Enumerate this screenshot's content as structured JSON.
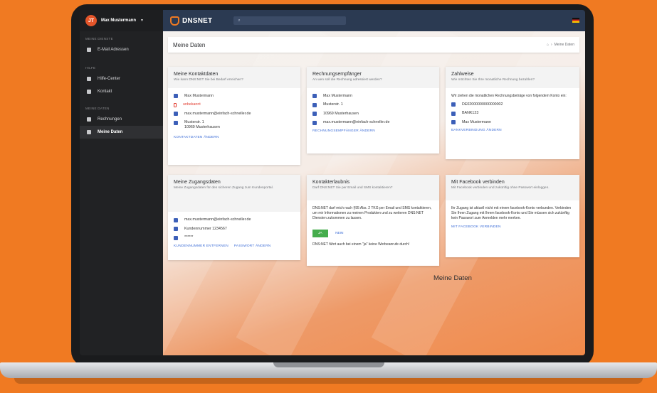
{
  "sidebar": {
    "user": {
      "initials": "JT",
      "name": "Max Mustermann"
    },
    "sections": [
      {
        "label": "MEINE DIENSTE",
        "items": [
          {
            "label": "E-Mail Adressen",
            "icon": "mail-icon"
          }
        ]
      },
      {
        "label": "HILFE",
        "items": [
          {
            "label": "Hilfe-Center",
            "icon": "book-icon"
          },
          {
            "label": "Kontakt",
            "icon": "chat-icon"
          }
        ]
      },
      {
        "label": "MEINE DATEN",
        "items": [
          {
            "label": "Rechnungen",
            "icon": "invoice-icon"
          },
          {
            "label": "Meine Daten",
            "icon": "card-icon",
            "active": true
          }
        ]
      }
    ]
  },
  "topbar": {
    "logo_text": "DNSNET",
    "search_placeholder": ""
  },
  "header": {
    "title": "Meine Daten",
    "breadcrumb_home": "home",
    "breadcrumb_current": "Meine Daten"
  },
  "cards": {
    "contact": {
      "title": "Meine Kontaktdaten",
      "subtitle": "Wie kann DNS:NET Sie bei Bedarf erreichen?",
      "rows": [
        "Max Mustermann",
        "unbekannt",
        "max.mustermann@einfach-schneller.de",
        "Musterstr. 1",
        "10969 Musterhausen"
      ],
      "link": "KONTAKTDATEN ÄNDERN"
    },
    "billing": {
      "title": "Rechnungsempfänger",
      "subtitle": "An wen soll die Rechnung adressiert werden?",
      "rows": [
        "Max Mustermann",
        "Musterstr. 1",
        "10969 Musterhausen",
        "max.mustermann@einfach-schneller.de"
      ],
      "link": "RECHNUNGSEMPFÄNGER ÄNDERN"
    },
    "payment": {
      "title": "Zahlweise",
      "subtitle": "Wie möchten Sie Ihre monatliche Rechnung bezahlen?",
      "intro": "Wir ziehen die monatlichen Rechnungsbeträge von folgendem Konto ein:",
      "rows": [
        "DE02000000000000002",
        "BANK123",
        "Max Mustermann"
      ],
      "link": "BANKVERBINDUNG ÄNDERN"
    },
    "access": {
      "title": "Meine Zugangsdaten",
      "subtitle": "Meine Zugangsdaten für den sicheren Zugang zum Kundenportal.",
      "rows": [
        "max.mustermann@einfach-schneller.de",
        "Kundennummer 1234567",
        "******"
      ],
      "link1": "KUNDENNUMMER ENTFERNEN",
      "link2": "PASSWORT ÄNDERN"
    },
    "consent": {
      "title": "Kontakterlaubnis",
      "subtitle": "Darf DNS:NET Sie per Email und SMS kontaktieren?",
      "text": "DNS:NET darf mich nach §95 Abs. 2 TKG per Email und SMS kontaktieren, um mir Informationen zu meinen Produkten und zu weiteren DNS:NET Diensten zukommen zu lassen.",
      "yes": "JA",
      "no": "NEIN",
      "note": "DNS:NET führt auch bei einem \"ja\" keine Werbeanrufe durch!"
    },
    "facebook": {
      "title": "Mit Facebook verbinden",
      "subtitle": "Mit Facebook verbinden und zukünftig ohne Passwort einloggen.",
      "text": "Ihr Zugang ist aktuell nicht mit einem facebook-Konto verbunden. Verbinden Sie Ihren Zugang mit Ihrem facebook-Konto und Sie müssen sich zukünftig kein Passwort zum Anmelden mehr merken.",
      "link": "MIT FACEBOOK VERBINDEN"
    }
  },
  "overlay_label": "Meine Daten",
  "colors": {
    "accent": "#f07a22",
    "topbar": "#2b3a52",
    "link": "#3a6bd6",
    "ok": "#45ad4c",
    "error": "#e23b2e"
  }
}
